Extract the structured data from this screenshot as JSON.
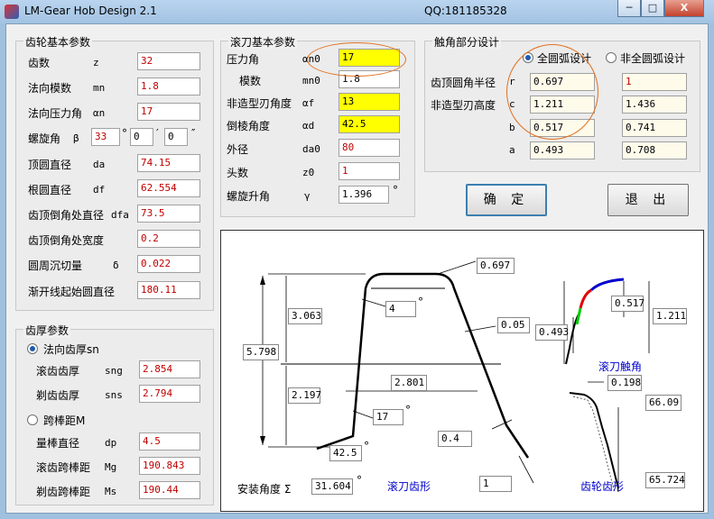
{
  "window": {
    "title": "LM-Gear Hob Design 2.1",
    "qq": "QQ:181185328",
    "minimize": "─",
    "maximize": "□",
    "close": "X"
  },
  "gear_basic": {
    "title": "齿轮基本参数",
    "items": [
      {
        "label": "齿数",
        "sym": "z",
        "value": "32"
      },
      {
        "label": "法向模数",
        "sym": "mn",
        "value": "1.8"
      },
      {
        "label": "法向压力角",
        "sym": "αn",
        "value": "17"
      },
      {
        "label": "螺旋角",
        "sym": "β",
        "value": ""
      },
      {
        "label": "顶圆直径",
        "sym": "da",
        "value": "74.15"
      },
      {
        "label": "根圆直径",
        "sym": "df",
        "value": "62.554"
      },
      {
        "label": "齿顶倒角处直径",
        "sym": "dfa",
        "value": "73.5"
      },
      {
        "label": "齿顶倒角处宽度",
        "sym": "",
        "value": "0.2"
      },
      {
        "label": "圆周沉切量",
        "sym": "δ",
        "value": "0.022"
      },
      {
        "label": "渐开线起始圆直径",
        "sym": "",
        "value": "180.11"
      }
    ],
    "helix": {
      "deg": "33",
      "deg_mark": "°",
      "min": "0",
      "min_mark": "′",
      "sec": "0",
      "sec_mark": "″"
    }
  },
  "tooth_thickness": {
    "title": "齿厚参数",
    "opt1": "法向齿厚sn",
    "items1": [
      {
        "label": "滚齿齿厚",
        "sym": "sng",
        "value": "2.854"
      },
      {
        "label": "剃齿齿厚",
        "sym": "sns",
        "value": "2.794"
      }
    ],
    "opt2": "跨棒距M",
    "items2": [
      {
        "label": "量棒直径",
        "sym": "dp",
        "value": "4.5"
      },
      {
        "label": "滚齿跨棒距",
        "sym": "Mg",
        "value": "190.843"
      },
      {
        "label": "剃齿跨棒距",
        "sym": "Ms",
        "value": "190.44"
      }
    ]
  },
  "hob_basic": {
    "title": "滚刀基本参数",
    "items": [
      {
        "label": "压力角",
        "sym": "αn0",
        "value": "17"
      },
      {
        "label": "模数",
        "sym": "mn0",
        "value": "1.8"
      },
      {
        "label": "非造型刃角度",
        "sym": "αf",
        "value": "13"
      },
      {
        "label": "倒棱角度",
        "sym": "αd",
        "value": "42.5"
      },
      {
        "label": "外径",
        "sym": "da0",
        "value": "80"
      },
      {
        "label": "头数",
        "sym": "z0",
        "value": "1"
      },
      {
        "label": "螺旋升角",
        "sym": "γ",
        "value": "1.396"
      }
    ],
    "lead_unit": "°"
  },
  "touch": {
    "title": "触角部分设计",
    "opt1": "全圆弧设计",
    "opt2": "非全圆弧设计",
    "label_r": "齿顶圆角半径",
    "label_c": "非造型刃高度",
    "rows": [
      {
        "sym": "r",
        "v1": "0.697",
        "v2": "1"
      },
      {
        "sym": "c",
        "v1": "1.211",
        "v2": "1.436"
      },
      {
        "sym": "b",
        "v1": "0.517",
        "v2": "0.741"
      },
      {
        "sym": "a",
        "v1": "0.493",
        "v2": "0.708"
      }
    ]
  },
  "buttons": {
    "ok": "确 定",
    "exit": "退 出"
  },
  "drawing": {
    "v0697": "0.697",
    "v3063": "3.063",
    "v4": "4",
    "deg": "°",
    "v005": "0.05",
    "v5798": "5.798",
    "v2801": "2.801",
    "v2197": "2.197",
    "v17": "17",
    "v04": "0.4",
    "v425": "42.5",
    "v1": "1",
    "install": "安装角度 Σ",
    "install_val": "31.604",
    "hob_profile": "滚刀齿形",
    "v0517": "0.517",
    "v1211": "1.211",
    "v0493": "0.493",
    "hob_touch": "滚刀触角",
    "v0198": "0.198",
    "v6609": "66.09",
    "v65724": "65.724",
    "gear_profile": "齿轮齿形"
  }
}
